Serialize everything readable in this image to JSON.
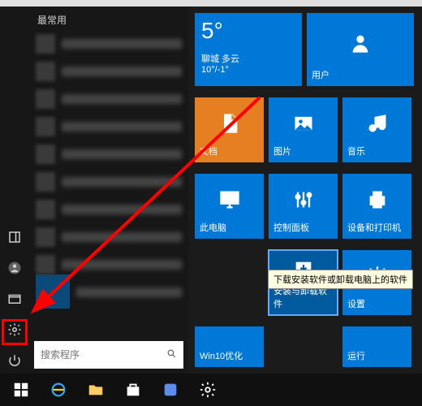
{
  "header": {
    "most_used": "最常用"
  },
  "search": {
    "placeholder": "搜索程序"
  },
  "weather": {
    "temp": "5°",
    "location": "聊城 多云",
    "range": "10°/-1°"
  },
  "tiles": {
    "user": "用户",
    "docs": "文档",
    "pictures": "图片",
    "music": "音乐",
    "this_pc": "此电脑",
    "control_panel": "控制面板",
    "devices_printers": "设备和打印机",
    "install_uninstall": "安装与卸载软件",
    "settings": "设置",
    "win10_opt": "Win10优化",
    "run": "运行"
  },
  "tooltip": "下载安装软件或卸载电脑上的软件"
}
